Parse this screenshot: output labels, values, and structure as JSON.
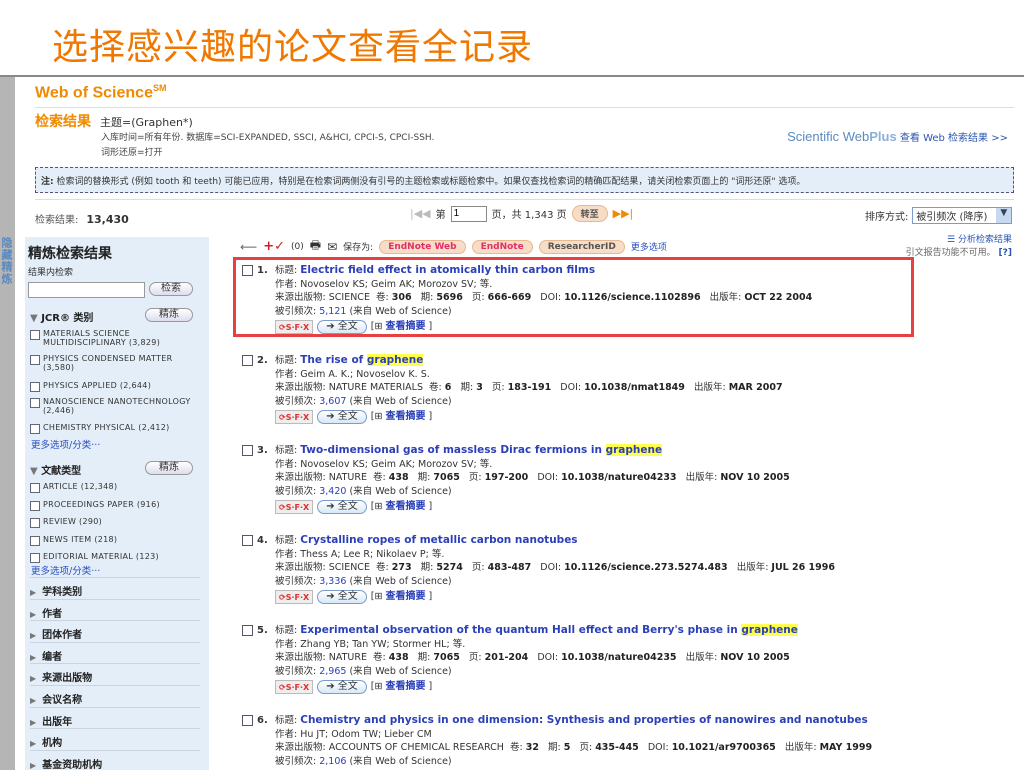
{
  "slide_title": "选择感兴趣的论文查看全记录",
  "header": {
    "brand": "Web of Science",
    "brand_sup": "SM",
    "results_label": "检索结果",
    "query": "主题=(Graphen*)",
    "query_meta": "入库时间=所有年份. 数据库=SCI-EXPANDED, SSCI, A&HCI, CPCI-S, CPCI-SSH.",
    "lemmatization": "词形还原=打开",
    "webplus_brand": "Scientific Web",
    "webplus_brand2": "Plus",
    "webplus_link": "查看 Web 检索结果 >>"
  },
  "note": {
    "label": "注:",
    "text": "检索词的替换形式 (例如 tooth 和 teeth) 可能已应用，特别是在检索词两侧没有引号的主题检索或标题检索中。如果仅查找检索词的精确匹配结果，请关闭检索页面上的 \"词形还原\" 选项。"
  },
  "count": {
    "label": "检索结果:",
    "value": "13,430"
  },
  "pager": {
    "page_prefix": "第",
    "page_value": "1",
    "page_suffix": "页，共 1,343 页",
    "go": "转至"
  },
  "sort": {
    "label": "排序方式:",
    "value": "被引频次 (降序)"
  },
  "toolbar": {
    "count": "(0)",
    "save_as": "保存为:",
    "endnote_web": "EndNote Web",
    "endnote": "EndNote",
    "researcherid": "ResearcherID",
    "more": "更多选项"
  },
  "analyze": {
    "link": "分析检索结果",
    "citation": "引文报告功能不可用。",
    "help": "[?]"
  },
  "sidebar": {
    "tab": "隐藏精炼",
    "title": "精炼检索结果",
    "within": "结果内检索",
    "search_btn": "检索",
    "refine": "精炼",
    "jcr_title": "JCR® 类别",
    "jcr": [
      "MATERIALS SCIENCE MULTIDISCIPLINARY (3,829)",
      "PHYSICS CONDENSED MATTER (3,580)",
      "PHYSICS APPLIED (2,644)",
      "NANOSCIENCE NANOTECHNOLOGY (2,446)",
      "CHEMISTRY PHYSICAL (2,412)"
    ],
    "more": "更多选项/分类···",
    "doc_title": "文献类型",
    "doc": [
      "ARTICLE (12,348)",
      "PROCEEDINGS PAPER (916)",
      "REVIEW (290)",
      "NEWS ITEM (218)",
      "EDITORIAL MATERIAL (123)"
    ],
    "facets": [
      "学科类别",
      "作者",
      "团体作者",
      "编者",
      "来源出版物",
      "会议名称",
      "出版年",
      "机构",
      "基金资助机构"
    ]
  },
  "labels": {
    "title": "标题:",
    "authors": "作者:",
    "source": "来源出版物:",
    "vol": "卷:",
    "issue": "期:",
    "pages": "页:",
    "doi": "DOI:",
    "year": "出版年:",
    "cited": "被引频次:",
    "from": "(来自  Web of Science)",
    "sfx": "S·F·X",
    "fulltext": "全文",
    "abstract": "查看摘要"
  },
  "records": [
    {
      "num": "1.",
      "title": "Electric field effect in atomically thin carbon films",
      "hl": "",
      "authors": "Novoselov KS; Geim AK; Morozov SV; 等.",
      "source": "SCIENCE",
      "vol": "306",
      "issue": "5696",
      "pages": "666-669",
      "doi": "10.1126/science.1102896",
      "year": "OCT 22 2004",
      "cited": "5,121"
    },
    {
      "num": "2.",
      "title": "The rise of ",
      "hl": "graphene",
      "authors": "Geim A. K.; Novoselov K. S.",
      "source": "NATURE MATERIALS",
      "vol": "6",
      "issue": "3",
      "pages": "183-191",
      "doi": "10.1038/nmat1849",
      "year": "MAR 2007",
      "cited": "3,607"
    },
    {
      "num": "3.",
      "title": "Two-dimensional gas of massless Dirac fermions in ",
      "hl": "graphene",
      "authors": "Novoselov KS; Geim AK; Morozov SV; 等.",
      "source": "NATURE",
      "vol": "438",
      "issue": "7065",
      "pages": "197-200",
      "doi": "10.1038/nature04233",
      "year": "NOV 10 2005",
      "cited": "3,420"
    },
    {
      "num": "4.",
      "title": "Crystalline ropes of metallic carbon nanotubes",
      "hl": "",
      "authors": "Thess A; Lee R; Nikolaev P; 等.",
      "source": "SCIENCE",
      "vol": "273",
      "issue": "5274",
      "pages": "483-487",
      "doi": "10.1126/science.273.5274.483",
      "year": "JUL 26 1996",
      "cited": "3,336"
    },
    {
      "num": "5.",
      "title": "Experimental observation of the quantum Hall effect and Berry's phase in ",
      "hl": "graphene",
      "authors": "Zhang YB; Tan YW; Stormer HL; 等.",
      "source": "NATURE",
      "vol": "438",
      "issue": "7065",
      "pages": "201-204",
      "doi": "10.1038/nature04235",
      "year": "NOV 10 2005",
      "cited": "2,965"
    },
    {
      "num": "6.",
      "title": "Chemistry and physics in one dimension: Synthesis and properties of nanowires and nanotubes",
      "hl": "",
      "authors": "Hu JT; Odom TW; Lieber CM",
      "source": "ACCOUNTS OF CHEMICAL RESEARCH",
      "vol": "32",
      "issue": "5",
      "pages": "435-445",
      "doi": "10.1021/ar9700365",
      "year": "MAY 1999",
      "cited": "2,106"
    }
  ]
}
